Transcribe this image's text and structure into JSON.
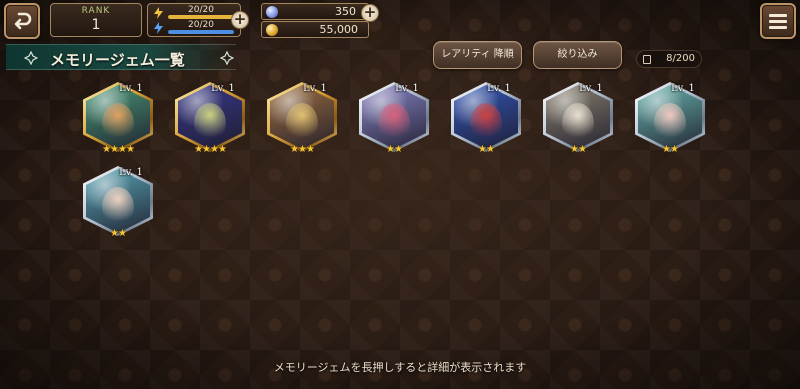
{
  "header": {
    "rank_label": "RANK",
    "rank_value": "1",
    "stamina": [
      {
        "text": "20/20",
        "fraction": 1.0,
        "color": "#e8b33a",
        "icon": "yellow-bolt-icon"
      },
      {
        "text": "20/20",
        "fraction": 1.0,
        "color": "#4e8ee0",
        "icon": "blue-bolt-icon"
      }
    ],
    "currencies": [
      {
        "value": "350",
        "icon": "gem-currency-icon"
      },
      {
        "value": "55,000",
        "icon": "gold-coin-icon"
      }
    ]
  },
  "title": "メモリージェム一覧",
  "buttons": {
    "sort": "レアリティ 降順",
    "filter": "絞り込み"
  },
  "count": "8/200",
  "gems": [
    {
      "level": "Lv. 1",
      "stars": 4,
      "frame": "gold",
      "tint": "#4a9a78",
      "accent": "#e0a060"
    },
    {
      "level": "Lv. 1",
      "stars": 4,
      "frame": "gold",
      "tint": "#3a3a8c",
      "accent": "#c9d080"
    },
    {
      "level": "Lv. 1",
      "stars": 3,
      "frame": "gold",
      "tint": "#a07040",
      "accent": "#e0c070"
    },
    {
      "level": "Lv. 1",
      "stars": 2,
      "frame": "silver",
      "tint": "#8a86c8",
      "accent": "#d8607a"
    },
    {
      "level": "Lv. 1",
      "stars": 2,
      "frame": "silver",
      "tint": "#3458b8",
      "accent": "#d04040"
    },
    {
      "level": "Lv. 1",
      "stars": 2,
      "frame": "silver",
      "tint": "#8c8470",
      "accent": "#e8e0d0"
    },
    {
      "level": "Lv. 1",
      "stars": 2,
      "frame": "silver",
      "tint": "#6ab8b0",
      "accent": "#f0c8c0"
    },
    {
      "level": "Lv. 1",
      "stars": 2,
      "frame": "silver",
      "tint": "#5aa8b8",
      "accent": "#f0d0c0"
    }
  ],
  "hint": "メモリージェムを長押しすると詳細が表示されます"
}
